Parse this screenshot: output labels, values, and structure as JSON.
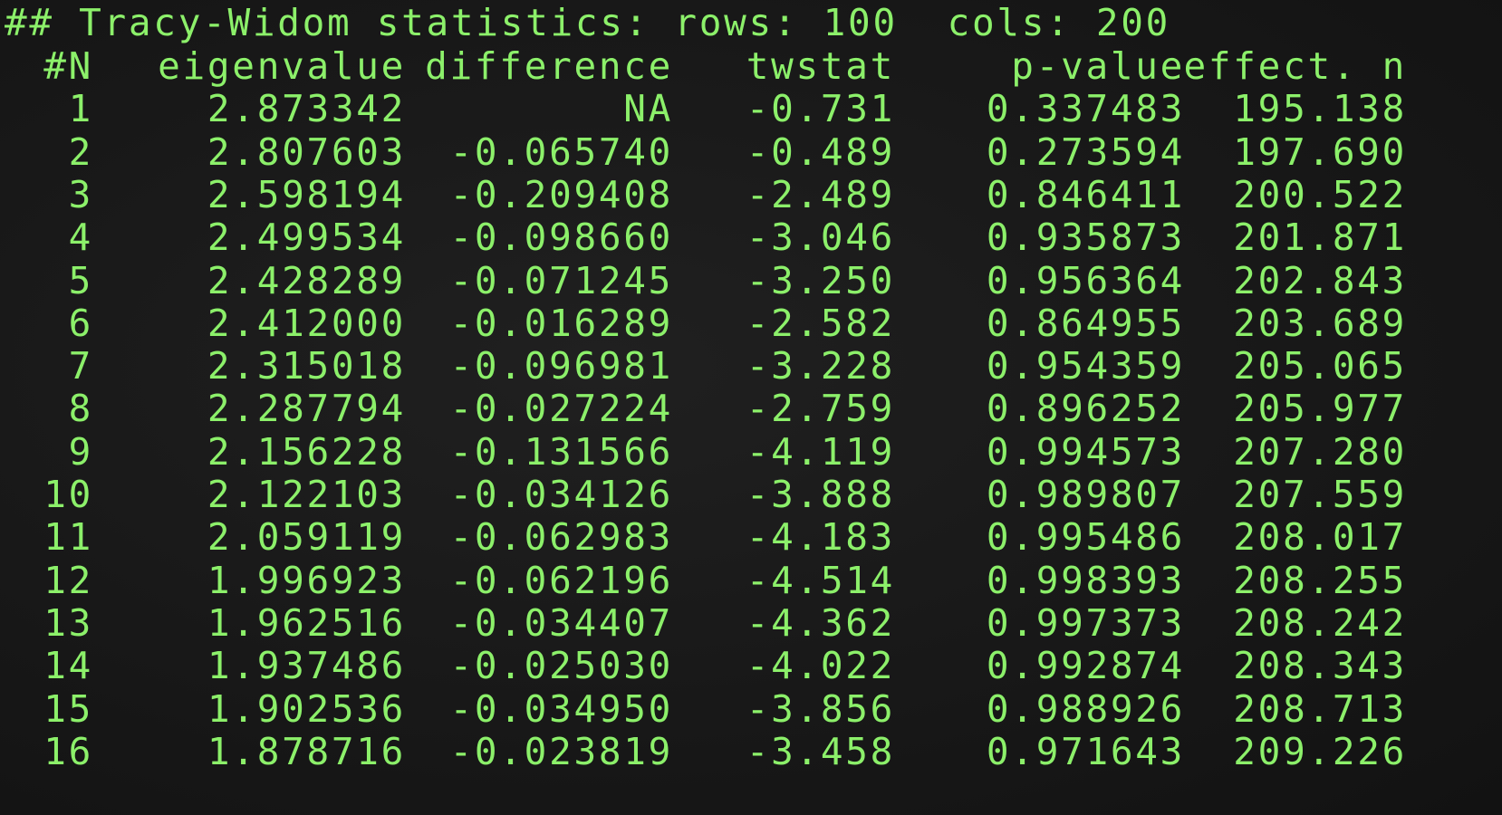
{
  "title": "## Tracy-Widom statistics: rows: 100  cols: 200",
  "columns": [
    "#N",
    "eigenvalue",
    "difference",
    "twstat",
    "p-value",
    "effect. n"
  ],
  "rows": [
    [
      "1",
      "2.873342",
      "NA",
      "-0.731",
      "0.337483",
      "195.138"
    ],
    [
      "2",
      "2.807603",
      "-0.065740",
      "-0.489",
      "0.273594",
      "197.690"
    ],
    [
      "3",
      "2.598194",
      "-0.209408",
      "-2.489",
      "0.846411",
      "200.522"
    ],
    [
      "4",
      "2.499534",
      "-0.098660",
      "-3.046",
      "0.935873",
      "201.871"
    ],
    [
      "5",
      "2.428289",
      "-0.071245",
      "-3.250",
      "0.956364",
      "202.843"
    ],
    [
      "6",
      "2.412000",
      "-0.016289",
      "-2.582",
      "0.864955",
      "203.689"
    ],
    [
      "7",
      "2.315018",
      "-0.096981",
      "-3.228",
      "0.954359",
      "205.065"
    ],
    [
      "8",
      "2.287794",
      "-0.027224",
      "-2.759",
      "0.896252",
      "205.977"
    ],
    [
      "9",
      "2.156228",
      "-0.131566",
      "-4.119",
      "0.994573",
      "207.280"
    ],
    [
      "10",
      "2.122103",
      "-0.034126",
      "-3.888",
      "0.989807",
      "207.559"
    ],
    [
      "11",
      "2.059119",
      "-0.062983",
      "-4.183",
      "0.995486",
      "208.017"
    ],
    [
      "12",
      "1.996923",
      "-0.062196",
      "-4.514",
      "0.998393",
      "208.255"
    ],
    [
      "13",
      "1.962516",
      "-0.034407",
      "-4.362",
      "0.997373",
      "208.242"
    ],
    [
      "14",
      "1.937486",
      "-0.025030",
      "-4.022",
      "0.992874",
      "208.343"
    ],
    [
      "15",
      "1.902536",
      "-0.034950",
      "-3.856",
      "0.988926",
      "208.713"
    ],
    [
      "16",
      "1.878716",
      "-0.023819",
      "-3.458",
      "0.971643",
      "209.226"
    ]
  ],
  "colors": {
    "background": "#181818",
    "text": "#8cf06a"
  }
}
